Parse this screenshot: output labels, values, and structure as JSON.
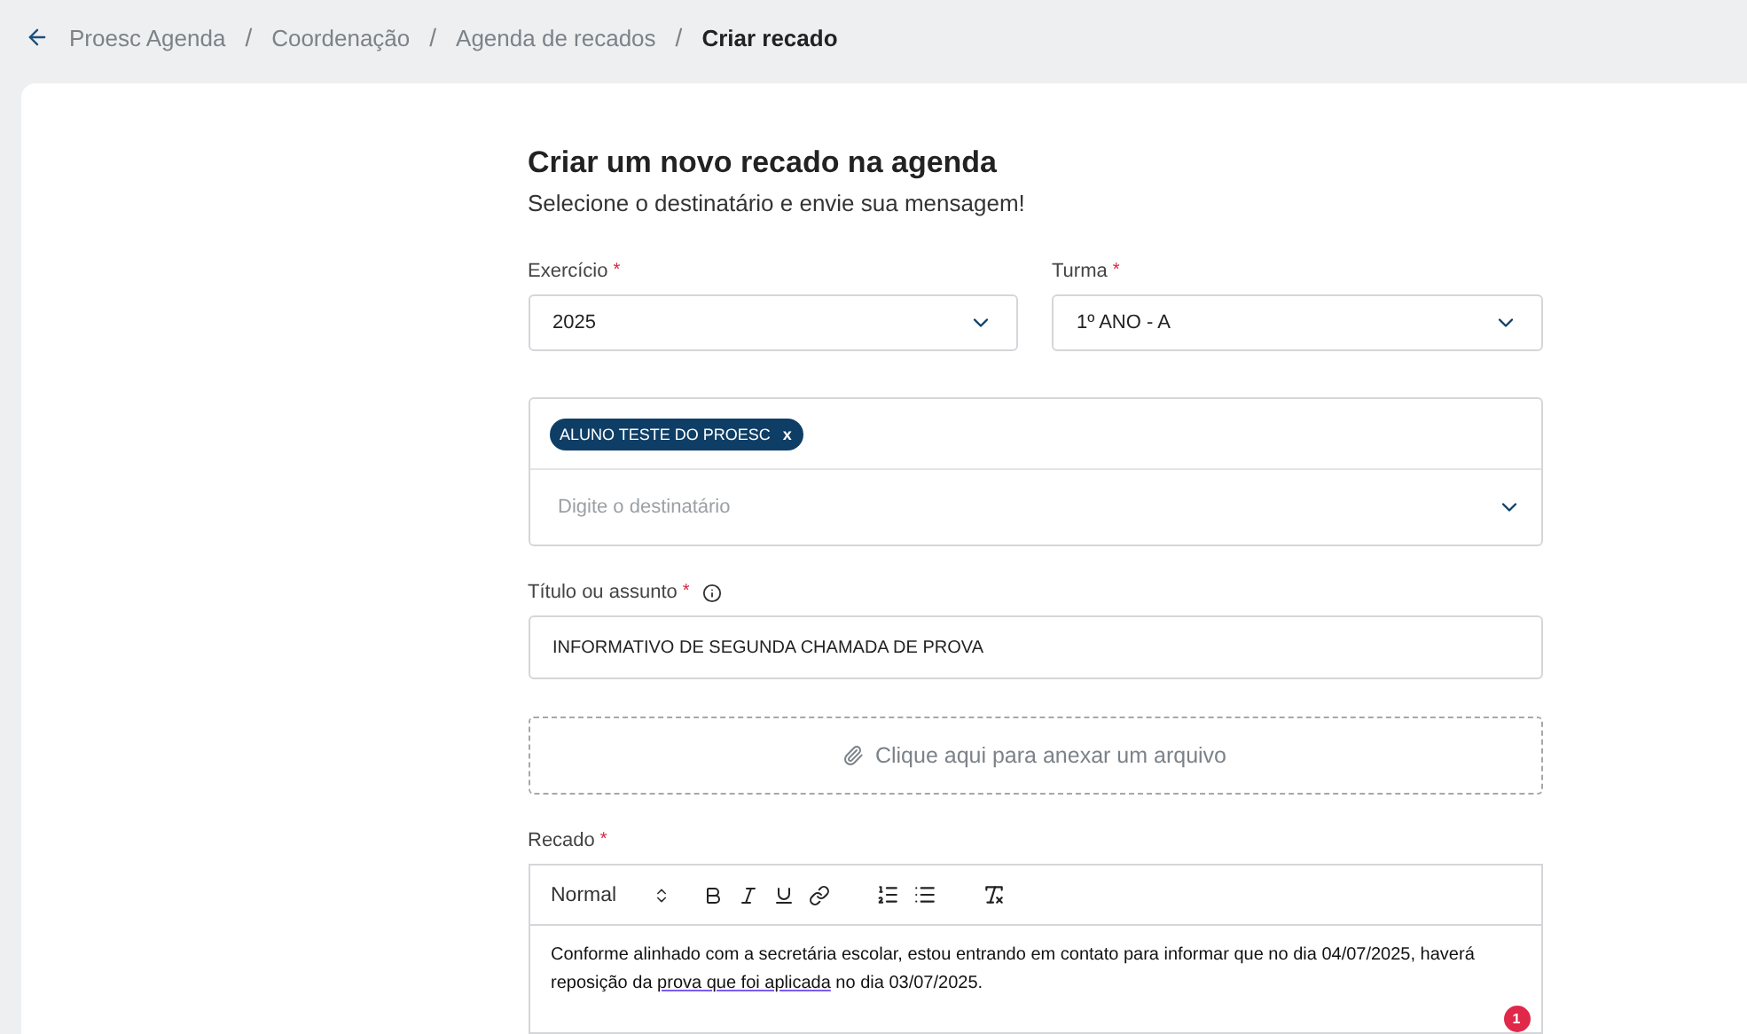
{
  "breadcrumb": {
    "items": [
      {
        "label": "Proesc Agenda",
        "current": false
      },
      {
        "label": "Coordenação",
        "current": false
      },
      {
        "label": "Agenda de recados",
        "current": false
      },
      {
        "label": "Criar recado",
        "current": true
      }
    ],
    "separator": "/"
  },
  "form": {
    "title": "Criar um novo recado na agenda",
    "subtitle": "Selecione o destinatário e envie sua mensagem!",
    "selects": [
      {
        "label": "Exercício",
        "required_mark": "*",
        "value": "2025"
      },
      {
        "label": "Turma",
        "required_mark": "*",
        "value": "1º ANO - A"
      }
    ],
    "recipients": {
      "tags": [
        {
          "label": "ALUNO TESTE DO PROESC",
          "remove": "x"
        }
      ],
      "placeholder": "Digite o destinatário"
    },
    "subject": {
      "label": "Título ou assunto",
      "required_mark": "*",
      "value": "INFORMATIVO DE SEGUNDA CHAMADA DE PROVA"
    },
    "attachment": {
      "label": "Clique aqui para anexar um arquivo"
    },
    "message": {
      "label": "Recado",
      "required_mark": "*",
      "format": "Normal",
      "segments": [
        {
          "text": "Conforme alinhado com a secretária escolar, estou entrando em contato para informar que no dia 04/07/2025, haverá reposição da ",
          "flagged": false
        },
        {
          "text": "prova que foi aplicada",
          "flagged": true
        },
        {
          "text": " no dia 03/07/2025.",
          "flagged": false
        }
      ],
      "issue_count": "1"
    }
  }
}
